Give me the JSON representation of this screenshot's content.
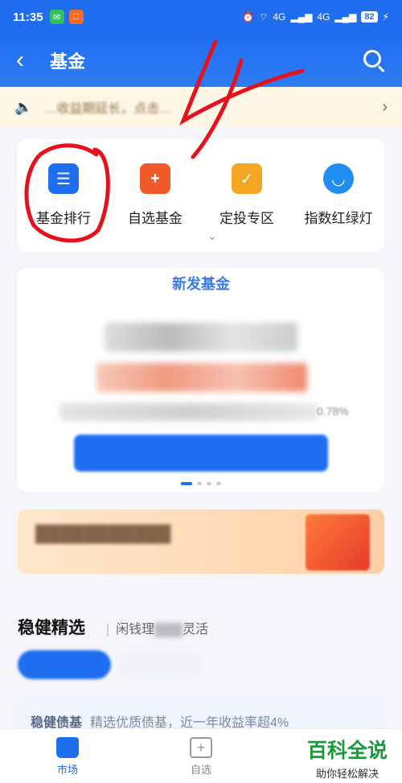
{
  "status": {
    "time": "11:35",
    "battery": "82",
    "net1": "4G",
    "net2": "4G"
  },
  "nav": {
    "title": "基金"
  },
  "notice": {
    "text": "…收益期延长，点击…"
  },
  "quick_items": [
    {
      "label": "基金排行",
      "color": "#1f6ef0"
    },
    {
      "label": "自选基金",
      "color": "#ee5a2a"
    },
    {
      "label": "定投专区",
      "color": "#f2a623"
    },
    {
      "label": "指数红绿灯",
      "color": "#1f8ef0"
    }
  ],
  "new_fund": {
    "title": "新发基金",
    "line_pct": "0.78%"
  },
  "section": {
    "title": "稳健精选",
    "sub_a": "闲钱理",
    "sub_b": "灵活"
  },
  "bond": {
    "title": "稳健债基",
    "desc": "精选优质债基，近一年收益率超4%"
  },
  "tabs": {
    "market": "市场",
    "watch": "自选"
  },
  "watermark": {
    "line1": "百科全说",
    "line2": "助你轻松解决"
  },
  "colors": {
    "primary": "#1f6ef0",
    "annotation": "#e8101c"
  }
}
